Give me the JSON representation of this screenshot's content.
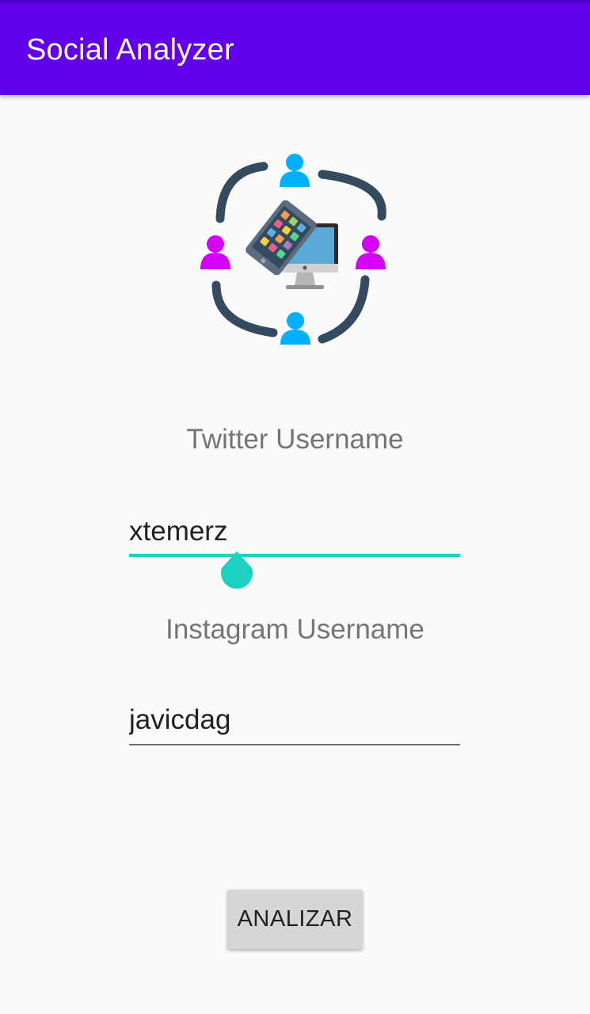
{
  "app_bar": {
    "title": "Social Analyzer",
    "color": "#6200ea"
  },
  "logo": {
    "icon": "social-network-devices-icon",
    "colors": {
      "ring": "#344a5e",
      "person_blue": "#00b0ff",
      "person_magenta": "#d500f9"
    }
  },
  "form": {
    "twitter": {
      "label": "Twitter Username",
      "value": "xtemerz",
      "focused": true
    },
    "instagram": {
      "label": "Instagram Username",
      "value": "javicdag",
      "focused": false
    }
  },
  "analyze_button": {
    "label": "ANALIZAR"
  },
  "accent_color": "#1dd1c0"
}
